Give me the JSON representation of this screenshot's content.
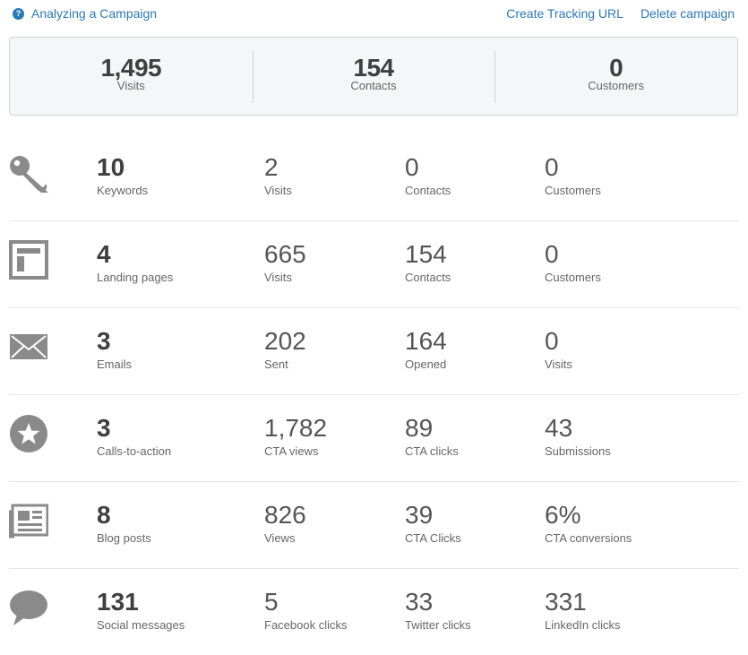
{
  "header": {
    "help_label": "Analyzing a Campaign",
    "help_icon_glyph": "?",
    "actions": [
      "Create Tracking URL",
      "Delete campaign"
    ]
  },
  "summary": [
    {
      "value": "1,495",
      "label": "Visits"
    },
    {
      "value": "154",
      "label": "Contacts"
    },
    {
      "value": "0",
      "label": "Customers"
    }
  ],
  "rows": [
    {
      "icon": "key-icon",
      "cells": [
        {
          "value": "10",
          "label": "Keywords"
        },
        {
          "value": "2",
          "label": "Visits"
        },
        {
          "value": "0",
          "label": "Contacts"
        },
        {
          "value": "0",
          "label": "Customers"
        }
      ]
    },
    {
      "icon": "landing-page-icon",
      "cells": [
        {
          "value": "4",
          "label": "Landing pages"
        },
        {
          "value": "665",
          "label": "Visits"
        },
        {
          "value": "154",
          "label": "Contacts"
        },
        {
          "value": "0",
          "label": "Customers"
        }
      ]
    },
    {
      "icon": "envelope-icon",
      "cells": [
        {
          "value": "3",
          "label": "Emails"
        },
        {
          "value": "202",
          "label": "Sent"
        },
        {
          "value": "164",
          "label": "Opened"
        },
        {
          "value": "0",
          "label": "Visits"
        }
      ]
    },
    {
      "icon": "star-icon",
      "cells": [
        {
          "value": "3",
          "label": "Calls-to-action"
        },
        {
          "value": "1,782",
          "label": "CTA views"
        },
        {
          "value": "89",
          "label": "CTA clicks"
        },
        {
          "value": "43",
          "label": "Submissions"
        }
      ]
    },
    {
      "icon": "newspaper-icon",
      "cells": [
        {
          "value": "8",
          "label": "Blog posts"
        },
        {
          "value": "826",
          "label": "Views"
        },
        {
          "value": "39",
          "label": "CTA Clicks"
        },
        {
          "value": "6%",
          "label": "CTA conversions"
        }
      ]
    },
    {
      "icon": "speech-bubble-icon",
      "cells": [
        {
          "value": "131",
          "label": "Social messages"
        },
        {
          "value": "5",
          "label": "Facebook clicks"
        },
        {
          "value": "33",
          "label": "Twitter clicks"
        },
        {
          "value": "331",
          "label": "LinkedIn clicks"
        }
      ]
    }
  ],
  "colors": {
    "link": "#2a7ab8",
    "icon": "#8a8a8a",
    "value_text": "#3f3f3f"
  }
}
